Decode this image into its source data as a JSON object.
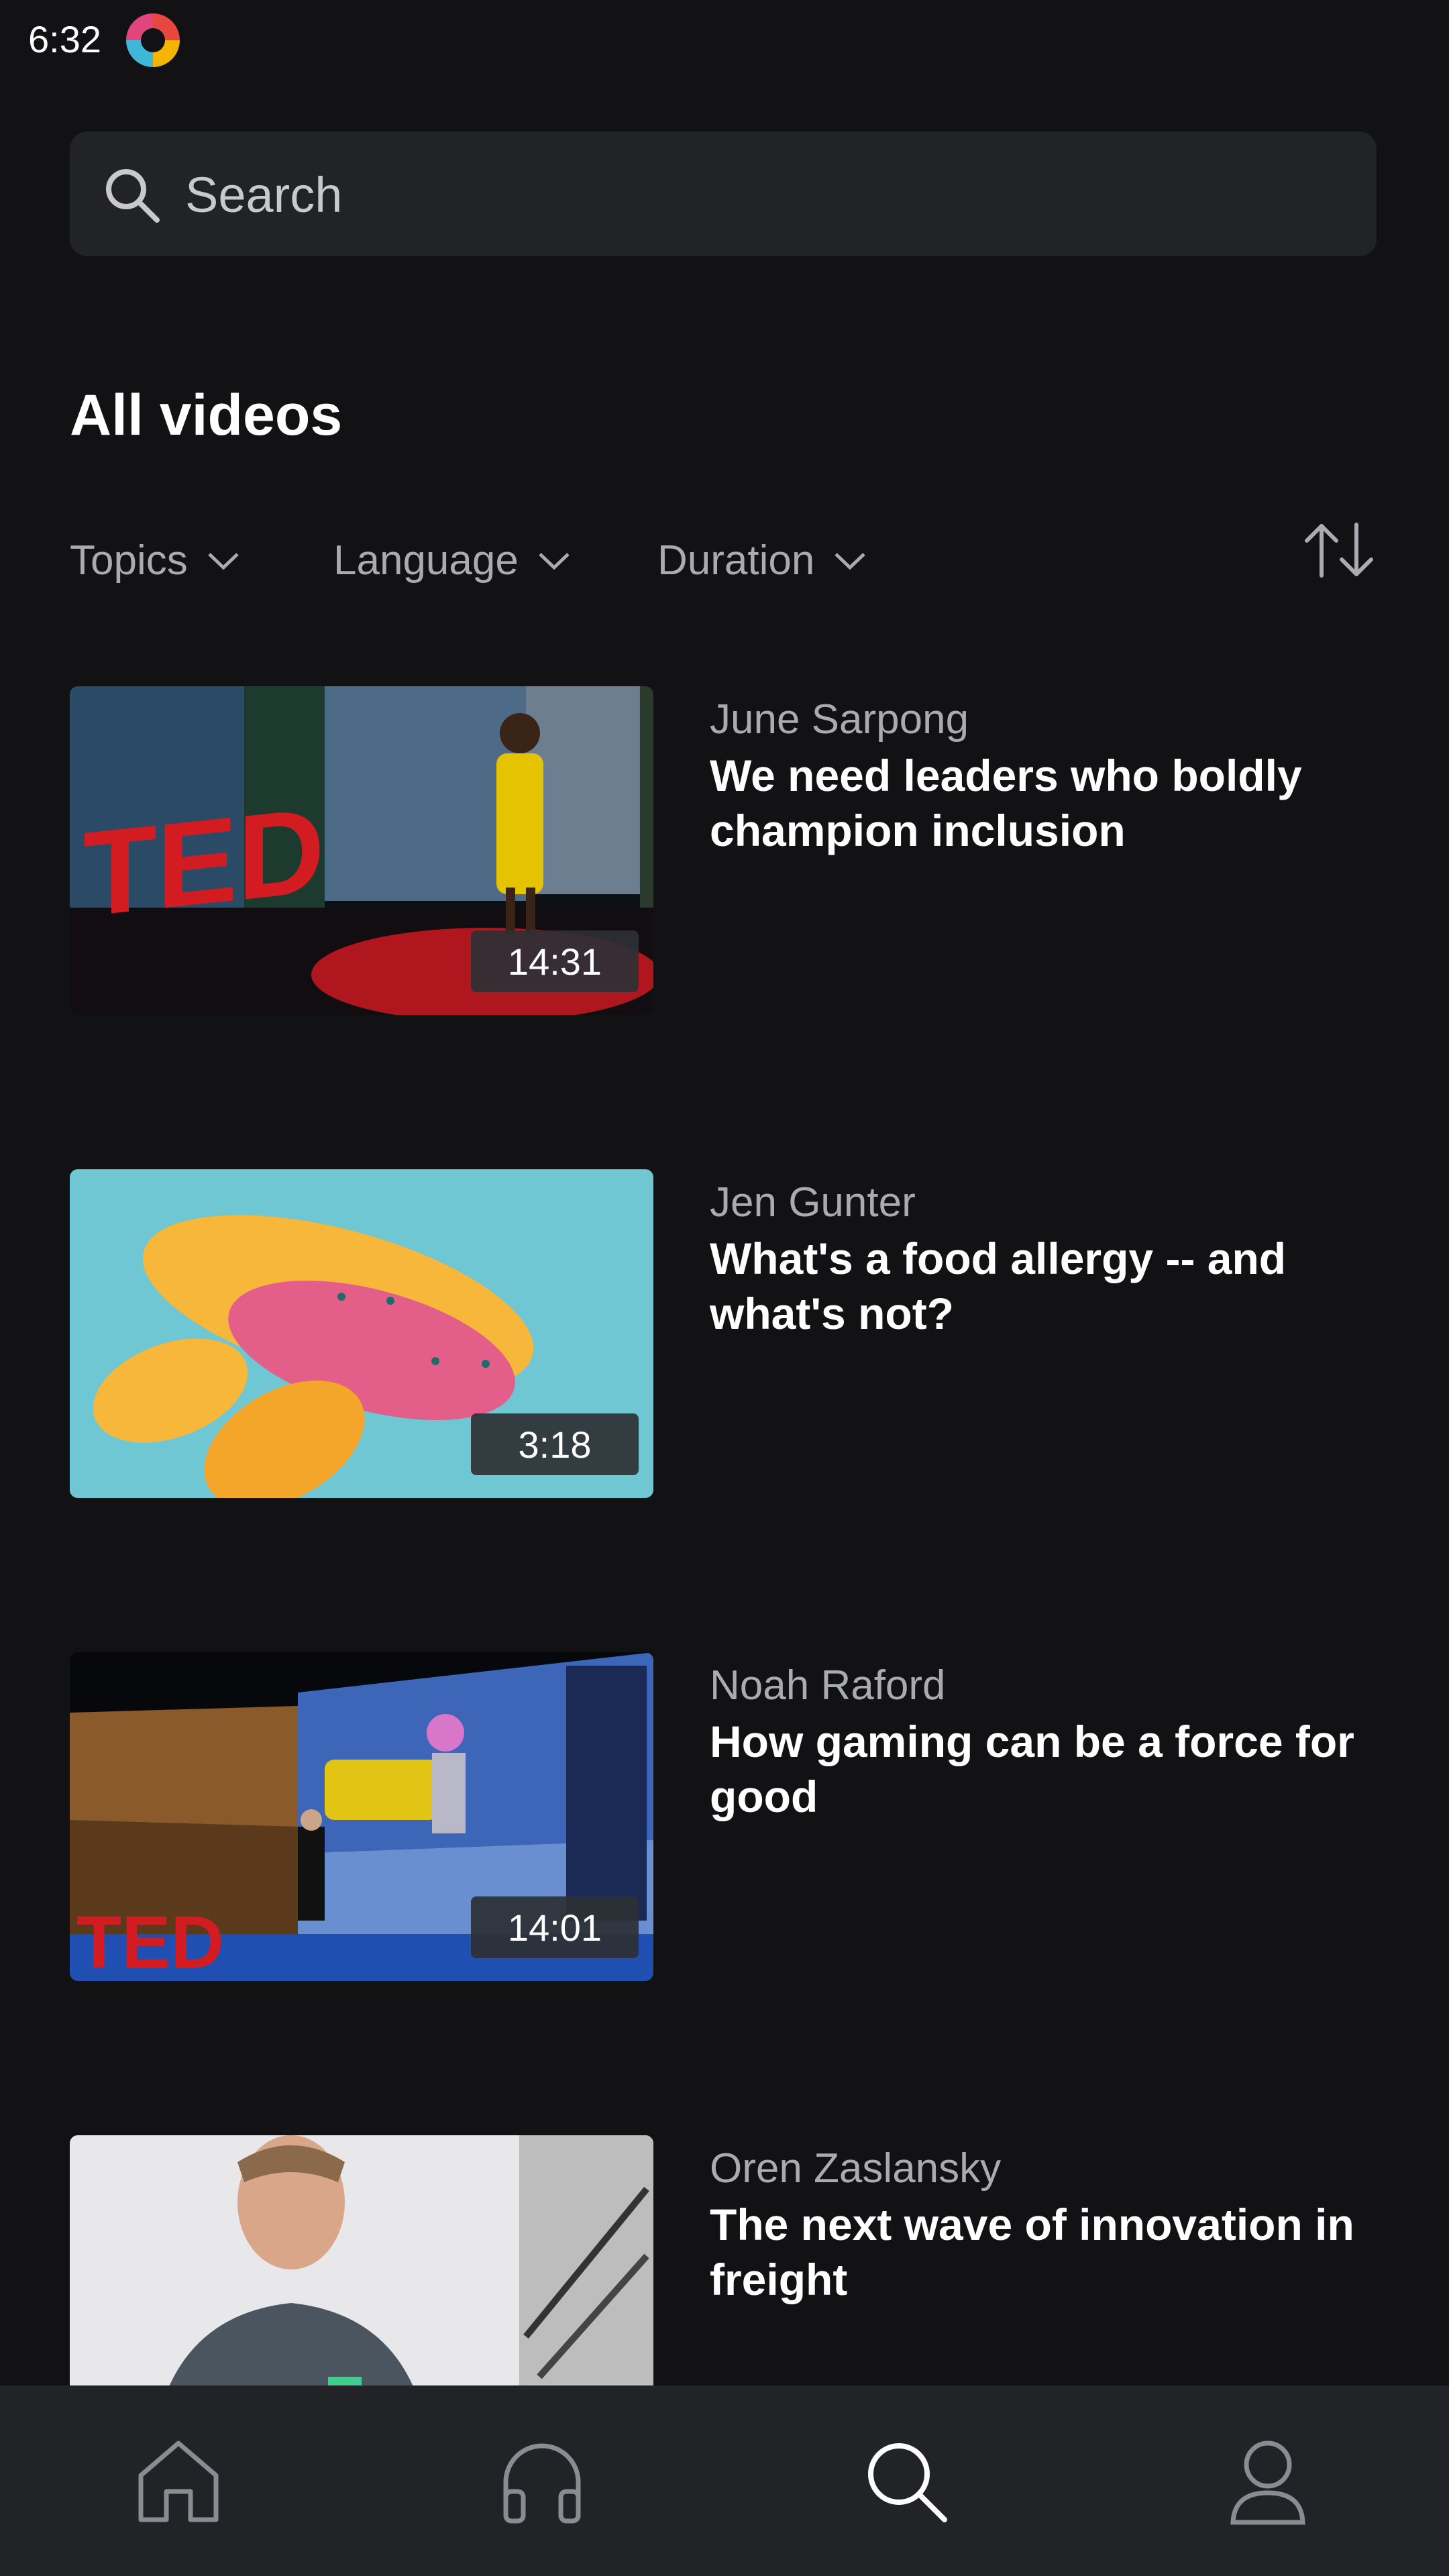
{
  "status_bar": {
    "time": "6:32"
  },
  "search": {
    "placeholder": "Search"
  },
  "page": {
    "title": "All videos"
  },
  "filters": [
    {
      "label": "Topics"
    },
    {
      "label": "Language"
    },
    {
      "label": "Duration"
    }
  ],
  "videos": [
    {
      "speaker": "June Sarpong",
      "title": "We need leaders who boldly champion inclusion",
      "duration": "14:31"
    },
    {
      "speaker": "Jen Gunter",
      "title": "What's a food allergy -- and what's not?",
      "duration": "3:18"
    },
    {
      "speaker": "Noah Raford",
      "title": "How gaming can be a force for good",
      "duration": "14:01"
    },
    {
      "speaker": "Oren Zaslansky",
      "title": "The next wave of innovation in freight",
      "duration": ""
    }
  ],
  "bottom_nav": [
    {
      "icon": "home-icon",
      "active": false
    },
    {
      "icon": "headphones-icon",
      "active": false
    },
    {
      "icon": "search-icon",
      "active": true
    },
    {
      "icon": "profile-icon",
      "active": false
    }
  ],
  "colors": {
    "background": "#121214",
    "surface": "#222327",
    "text_secondary": "#a9abb0",
    "brand_red": "#e62b1e"
  }
}
